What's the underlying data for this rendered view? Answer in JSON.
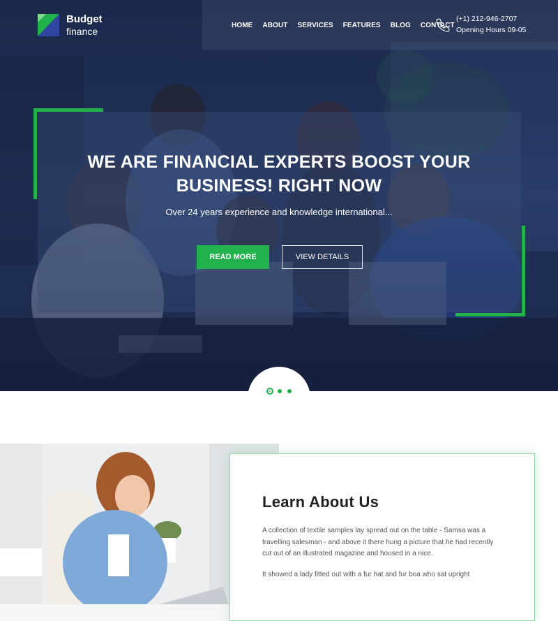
{
  "header": {
    "logo_line1": "Budget",
    "logo_line2": "finance",
    "nav": [
      "HOME",
      "ABOUT",
      "SERVICES",
      "FEATURES",
      "BLOG",
      "CONTACT"
    ],
    "phone": "(+1) 212-946-2707",
    "hours": "Opening Hours 09-05"
  },
  "hero": {
    "title": "WE ARE FINANCIAL EXPERTS BOOST YOUR BUSINESS! RIGHT NOW",
    "subtitle": "Over 24 years experience and knowledge international...",
    "primary_button": "READ MORE",
    "secondary_button": "VIEW DETAILS",
    "slides_total": 3,
    "active_slide": 1
  },
  "about": {
    "title": "Learn About Us",
    "paragraph1": "A collection of textile samples lay spread out on the table - Samsa was a travelling salesman - and above it there hung a picture that he had recently cut out of an illustrated magazine and housed in a nice.",
    "paragraph2": "It showed a lady fitted out with a fur hat and fur boa who sat upright"
  },
  "colors": {
    "accent_green": "#22b24c",
    "logo_blue": "#2f45a0",
    "hero_overlay": "#1f3060"
  },
  "icons": [
    "phone-icon"
  ]
}
